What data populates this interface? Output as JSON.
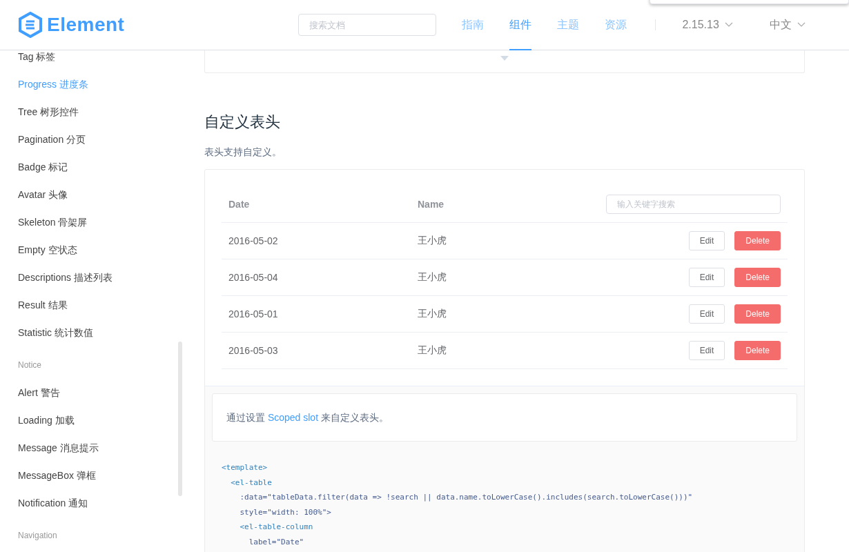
{
  "header": {
    "logo": "Element",
    "search": {
      "placeholder": "搜索文档"
    },
    "nav": [
      {
        "label": "指南",
        "selected": false
      },
      {
        "label": "组件",
        "selected": true
      },
      {
        "label": "主题",
        "selected": false
      },
      {
        "label": "资源",
        "selected": false
      }
    ],
    "version": "2.15.13",
    "language": "中文"
  },
  "sidebar": {
    "groups": [
      {
        "items": [
          {
            "label": "Tag 标签",
            "selected": false
          },
          {
            "label": "Progress 进度条",
            "selected": true
          },
          {
            "label": "Tree 树形控件",
            "selected": false
          },
          {
            "label": "Pagination 分页",
            "selected": false
          },
          {
            "label": "Badge 标记",
            "selected": false
          },
          {
            "label": "Avatar 头像",
            "selected": false
          },
          {
            "label": "Skeleton 骨架屏",
            "selected": false
          },
          {
            "label": "Empty 空状态",
            "selected": false
          },
          {
            "label": "Descriptions 描述列表",
            "selected": false
          },
          {
            "label": "Result 结果",
            "selected": false
          },
          {
            "label": "Statistic 统计数值",
            "selected": false
          }
        ]
      },
      {
        "title": "Notice",
        "items": [
          {
            "label": "Alert 警告",
            "selected": false
          },
          {
            "label": "Loading 加载",
            "selected": false
          },
          {
            "label": "Message 消息提示",
            "selected": false
          },
          {
            "label": "MessageBox 弹框",
            "selected": false
          },
          {
            "label": "Notification 通知",
            "selected": false
          }
        ]
      },
      {
        "title": "Navigation"
      }
    ]
  },
  "section": {
    "title": "自定义表头",
    "description": "表头支持自定义。",
    "table": {
      "columns": [
        "Date",
        "Name"
      ],
      "search_placeholder": "输入关键字搜索",
      "rows": [
        {
          "date": "2016-05-02",
          "name": "王小虎",
          "actions": [
            "Edit",
            "Delete"
          ]
        },
        {
          "date": "2016-05-04",
          "name": "王小虎",
          "actions": [
            "Edit",
            "Delete"
          ]
        },
        {
          "date": "2016-05-01",
          "name": "王小虎",
          "actions": [
            "Edit",
            "Delete"
          ]
        },
        {
          "date": "2016-05-03",
          "name": "王小虎",
          "actions": [
            "Edit",
            "Delete"
          ]
        }
      ]
    },
    "note": {
      "before": "通过设置 ",
      "link": "Scoped slot",
      "after": " 来自定义表头。"
    },
    "code": [
      {
        "kind": "tag",
        "text": "<template>"
      },
      {
        "kind": "tag",
        "text": "  <el-table"
      },
      {
        "kind": "attr",
        "text": "    :data=\"tableData.filter(data => !search || data.name.toLowerCase().includes(search.toLowerCase()))\""
      },
      {
        "kind": "attr",
        "text": "    style=\"width: 100%\">"
      },
      {
        "kind": "tag",
        "text": "    <el-table-column"
      },
      {
        "kind": "attr",
        "text": "      label=\"Date\""
      }
    ]
  }
}
